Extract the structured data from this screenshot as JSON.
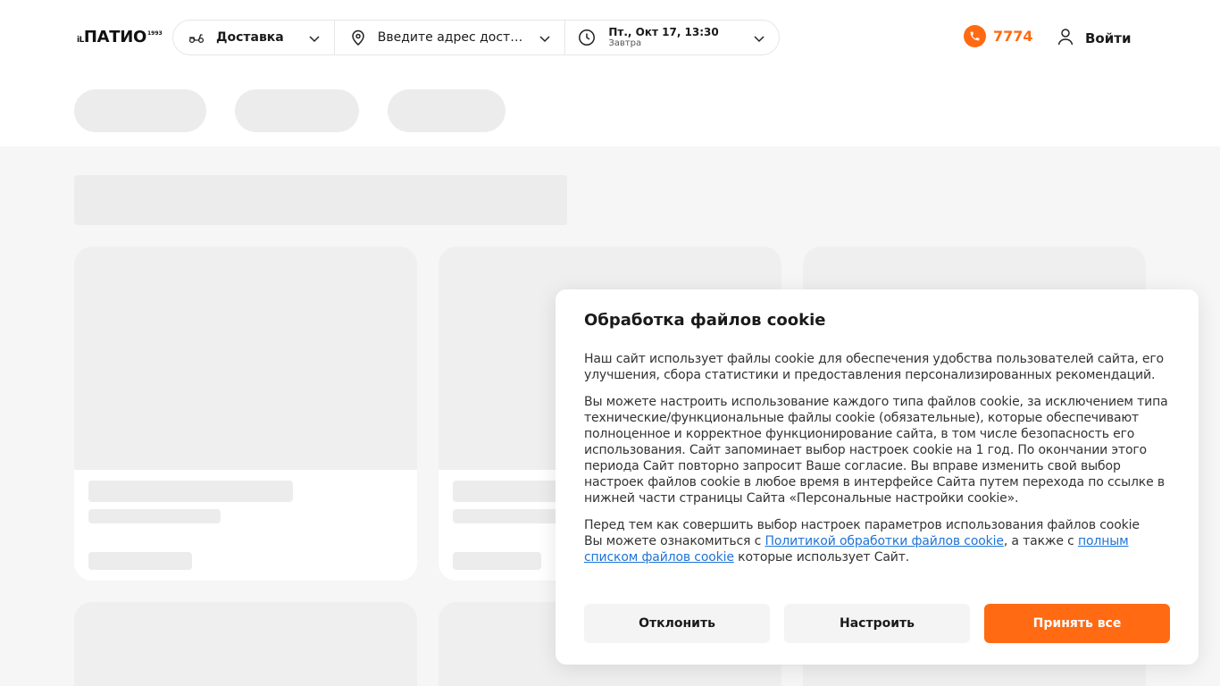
{
  "header": {
    "logo": {
      "prefix": "iL",
      "name": "ПАТИО",
      "year": "1993"
    },
    "delivery_mode": "Доставка",
    "address_placeholder": "Введите адрес доста...",
    "time_main": "Пт., Окт 17, 13:30",
    "time_sub": "Завтра",
    "phone": "7774",
    "login": "Войти"
  },
  "cookie": {
    "title": "Обработка файлов cookie",
    "p1": "Наш сайт использует файлы cookie для обеспечения удобства пользователей сайта, его улучшения, сбора статистики и предоставления персонализированных рекомендаций.",
    "p2": "Вы можете настроить использование каждого типа файлов cookie, за исключением типа технические/функциональные файлы cookie (обязательные), которые обеспечивают полноценное и корректное функционирование сайта, в том числе безопасность его использования. Сайт запоминает выбор настроек cookie на 1 год. По окончании этого периода Сайт повторно запросит Ваше согласие. Вы вправе изменить свой выбор настроек файлов cookie в любое время в интерфейсе Сайта путем перехода по ссылке в нижней части страницы Сайта «Персональные настройки cookie».",
    "p3_line1": "Перед тем как совершить выбор настроек параметров использования файлов cookie",
    "p3_before_link1": "Вы можете ознакомиться с ",
    "link1": "Политикой обработки файлов cookie",
    "p3_between": ", а также с ",
    "link2": "полным списком файлов cookie",
    "p3_after": " которые использует Сайт.",
    "btn_decline": "Отклонить",
    "btn_settings": "Настроить",
    "btn_accept": "Принять все"
  },
  "colors": {
    "accent": "#ff6a13",
    "link": "#1f74d6",
    "skeleton": "#ececec"
  },
  "icons": [
    "scooter-icon",
    "map-pin-icon",
    "clock-icon",
    "chevron-down-icon",
    "phone-icon",
    "user-icon"
  ]
}
